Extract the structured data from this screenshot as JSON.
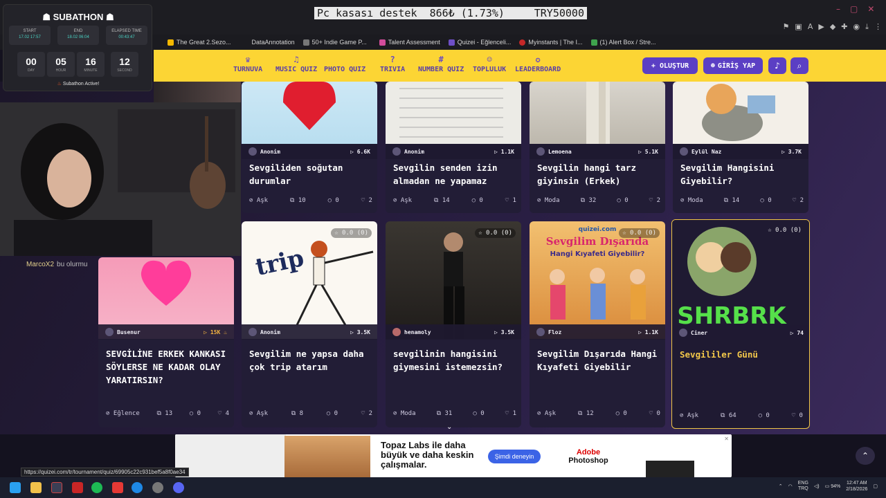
{
  "browser": {
    "bookmarks": [
      "The Great 2.Sezo...",
      "DataAnnotation",
      "50+ Indie Game P...",
      "Talent Assessment",
      "Quizei - Eğlenceli...",
      "Myinstants | The I...",
      "(1) Alert Box / Stre..."
    ],
    "status_url": "https://quizei.com/tr/tournament/quiz/69905c22c931bef5a8f0ae34"
  },
  "donation_bar": {
    "label": "Pc kasası destek",
    "amount": "866₺",
    "percent": "(1.73%)",
    "goal": "TRY50000"
  },
  "subathon": {
    "title": "SUBATHON",
    "start_label": "START",
    "start_value": "17.02 17:57",
    "end_label": "END",
    "end_value": "18.02 06:04",
    "elapsed_label": "ELAPSED TIME",
    "elapsed_value": "00:43:47",
    "day": "00",
    "day_label": "DAY",
    "hour": "05",
    "hour_label": "HOUR",
    "minute": "16",
    "minute_label": "MINUTE",
    "second": "12",
    "second_label": "SECOND",
    "status": "Subathon Active!"
  },
  "chat": {
    "user": "MarcoX2",
    "message": "bu olurmu"
  },
  "nav": {
    "items": [
      "TURNUVA",
      "MUSIC QUIZ",
      "PHOTO QUIZ",
      "TRIVIA",
      "NUMBER QUIZ",
      "TOPLULUK",
      "LEADERBOARD"
    ],
    "create": "+ OLUŞTUR",
    "login": "GİRİŞ YAP"
  },
  "cards_row1": [
    {
      "author": "Anonim",
      "plays": "6.6K",
      "title": "Sevgiliden soğutan durumlar",
      "category": "Aşk",
      "questions": "10",
      "comments": "0",
      "likes": "2"
    },
    {
      "author": "Anonim",
      "plays": "1.1K",
      "title": "Sevgilin senden izin almadan ne yapamaz",
      "category": "Aşk",
      "questions": "14",
      "comments": "0",
      "likes": "1"
    },
    {
      "author": "Lemoena",
      "plays": "5.1K",
      "title": "Sevgilin hangi tarz giyinsin (Erkek)",
      "category": "Moda",
      "questions": "32",
      "comments": "0",
      "likes": "2"
    },
    {
      "author": "Eylül Naz",
      "plays": "3.7K",
      "title": "Sevgilim Hangisini Giyebilir?",
      "category": "Moda",
      "questions": "14",
      "comments": "0",
      "likes": "2"
    }
  ],
  "cards_row2": [
    {
      "author": "Busenur",
      "plays": "15K",
      "title": "SEVGİLİNE ERKEK KANKASI SÖYLERSE NE KADAR OLAY YARATIRSIN?",
      "category": "Eğlence",
      "questions": "13",
      "comments": "0",
      "likes": "4",
      "rating": ""
    },
    {
      "author": "Anonim",
      "plays": "3.5K",
      "title": "Sevgilim ne yapsa daha çok trip atarım",
      "category": "Aşk",
      "questions": "8",
      "comments": "0",
      "likes": "2",
      "rating": "☆ 0.0 (0)",
      "thumb_text": "trip"
    },
    {
      "author": "henamoly",
      "plays": "3.5K",
      "title": "sevgilinin hangisini giymesini istemezsin?",
      "category": "Moda",
      "questions": "31",
      "comments": "0",
      "likes": "1",
      "rating": "☆ 0.0 (0)"
    },
    {
      "author": "Floz",
      "plays": "1.1K",
      "title": "Sevgilim Dışarıda Hangi Kıyafeti Giyebilir",
      "category": "Aşk",
      "questions": "12",
      "comments": "0",
      "likes": "0",
      "rating": "☆ 0.0 (0)",
      "thumb_site": "quizei.com",
      "thumb_title": "Sevgilim Dışarıda",
      "thumb_sub": "Hangi Kıyafeti Giyebilir?"
    },
    {
      "author": "Ciner",
      "plays": "74",
      "title": "Sevgililer Günü",
      "category": "Aşk",
      "questions": "64",
      "comments": "0",
      "likes": "0",
      "rating": "☆ 0.0 (0)",
      "thumb_text": "SHRBRK"
    }
  ],
  "ad": {
    "text": "Topaz Labs ile daha büyük ve daha keskin çalışmalar.",
    "button": "Şimdi deneyin",
    "brand_top": "Adobe",
    "brand": "Photoshop"
  },
  "taskbar": {
    "lang_top": "ENG",
    "lang_bottom": "TRQ",
    "battery": "94%",
    "time": "12:47 AM",
    "date": "2/18/2026"
  }
}
